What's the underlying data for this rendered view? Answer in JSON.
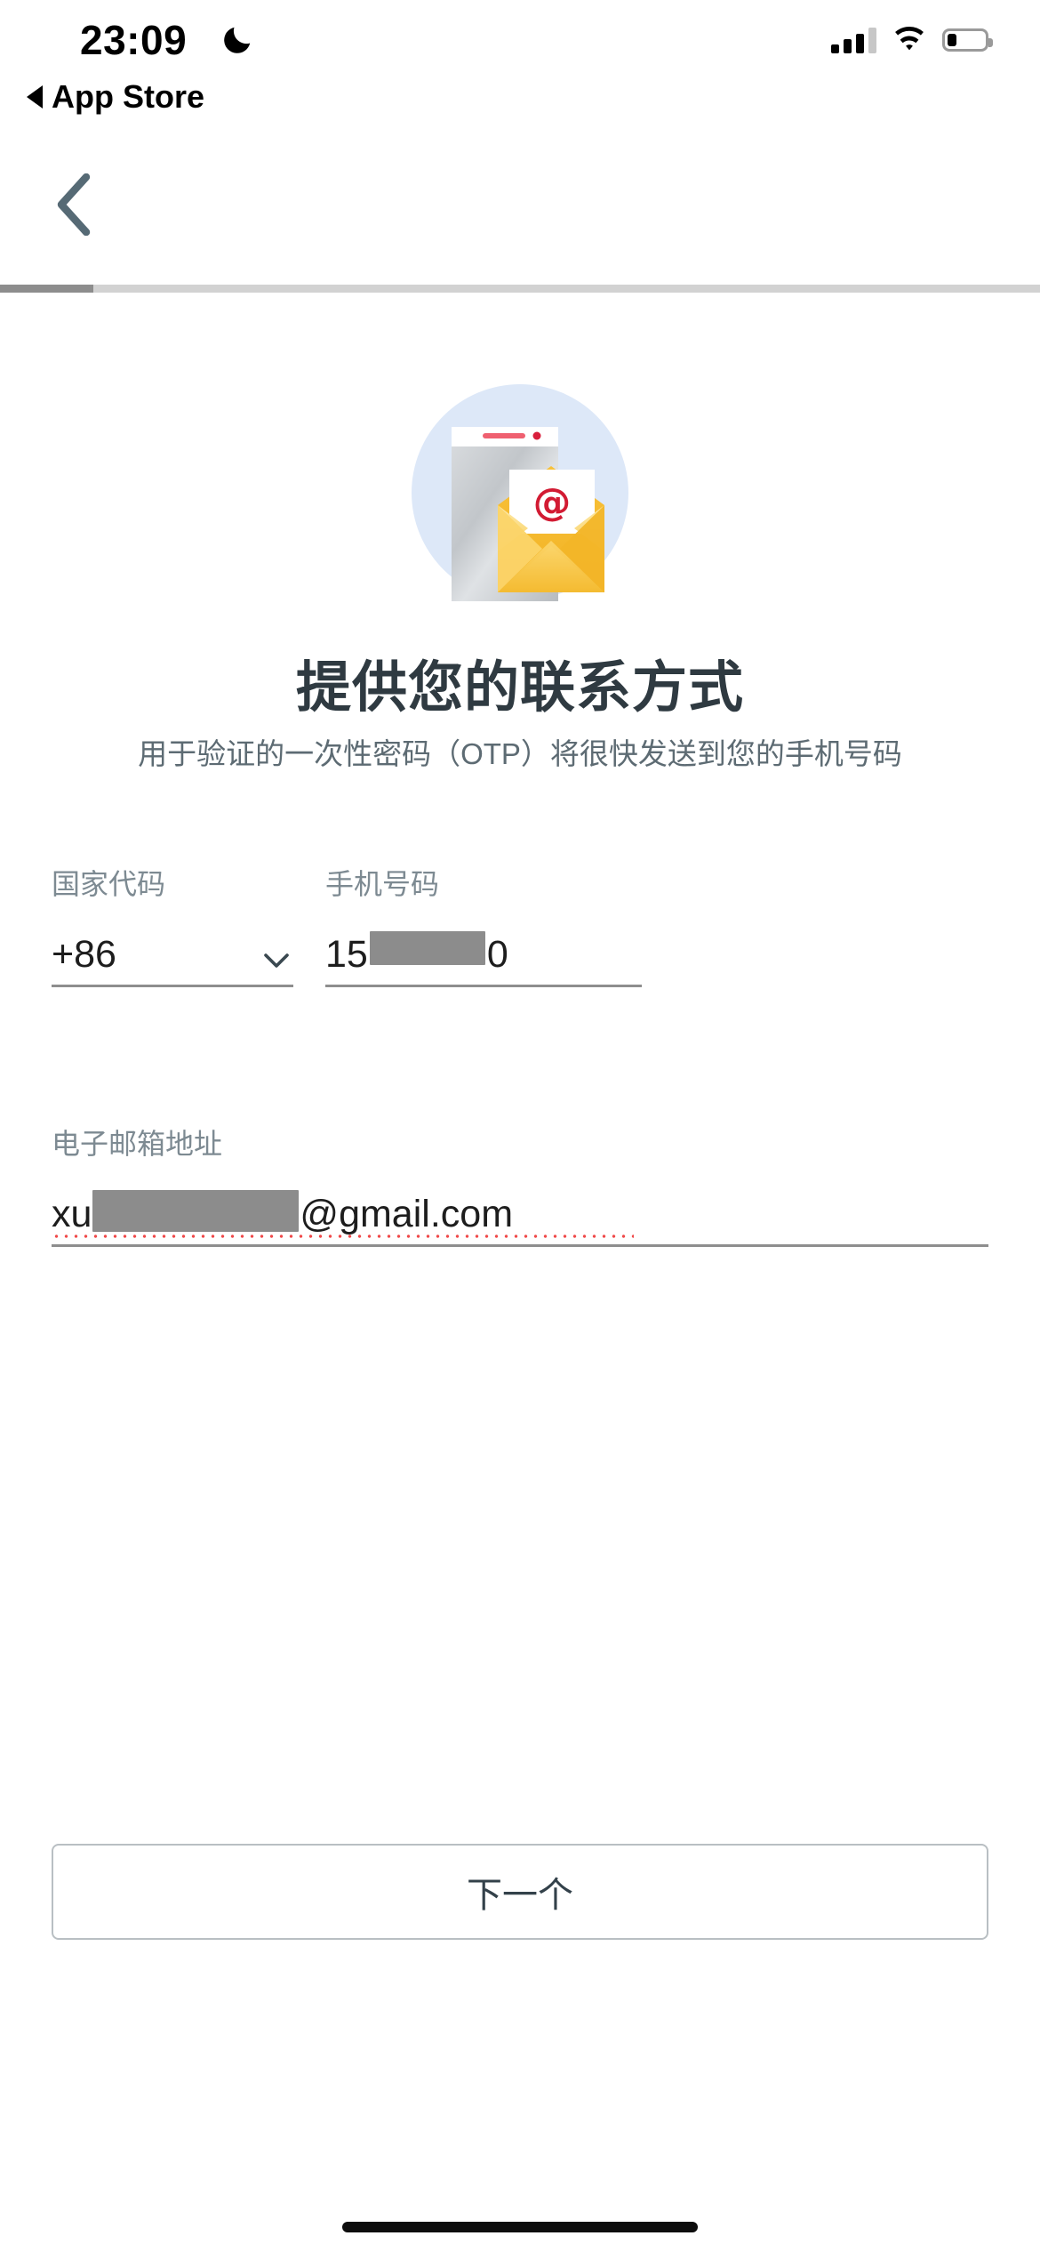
{
  "status_bar": {
    "time": "23:09",
    "dnd_icon": "moon-icon",
    "signal_icon": "cellular-signal-icon",
    "signal_bars_filled": 3,
    "signal_bars_total": 4,
    "wifi_icon": "wifi-icon",
    "battery_icon": "battery-icon",
    "battery_percent": 25
  },
  "back_to_app": {
    "label": "App Store",
    "icon": "back-triangle-icon"
  },
  "nav": {
    "back_icon": "chevron-left-icon",
    "back_icon_color": "#566a75"
  },
  "progress": {
    "percent": 9,
    "fill_color": "#8d8d8d",
    "track_color": "#d2d2d2"
  },
  "hero": {
    "icon": "email-phone-illustration",
    "circle_color": "#dde8f8",
    "envelope_color": "#f9d05f",
    "at_symbol_color": "#d21b33"
  },
  "main": {
    "title": "提供您的联系方式",
    "subtitle": "用于验证的一次性密码（OTP）将很快发送到您的手机号码"
  },
  "form": {
    "country_code": {
      "label": "国家代码",
      "value": "+86",
      "dropdown_icon": "chevron-down-icon"
    },
    "phone": {
      "label": "手机号码",
      "value_prefix": "15",
      "value_suffix": "0",
      "redacted": true
    },
    "email": {
      "label": "电子邮箱地址",
      "value_prefix": "xu",
      "value_suffix": "@gmail.com",
      "redacted": true,
      "spellcheck_underline_color": "#f04a4a"
    }
  },
  "footer": {
    "next_label": "下一个"
  }
}
